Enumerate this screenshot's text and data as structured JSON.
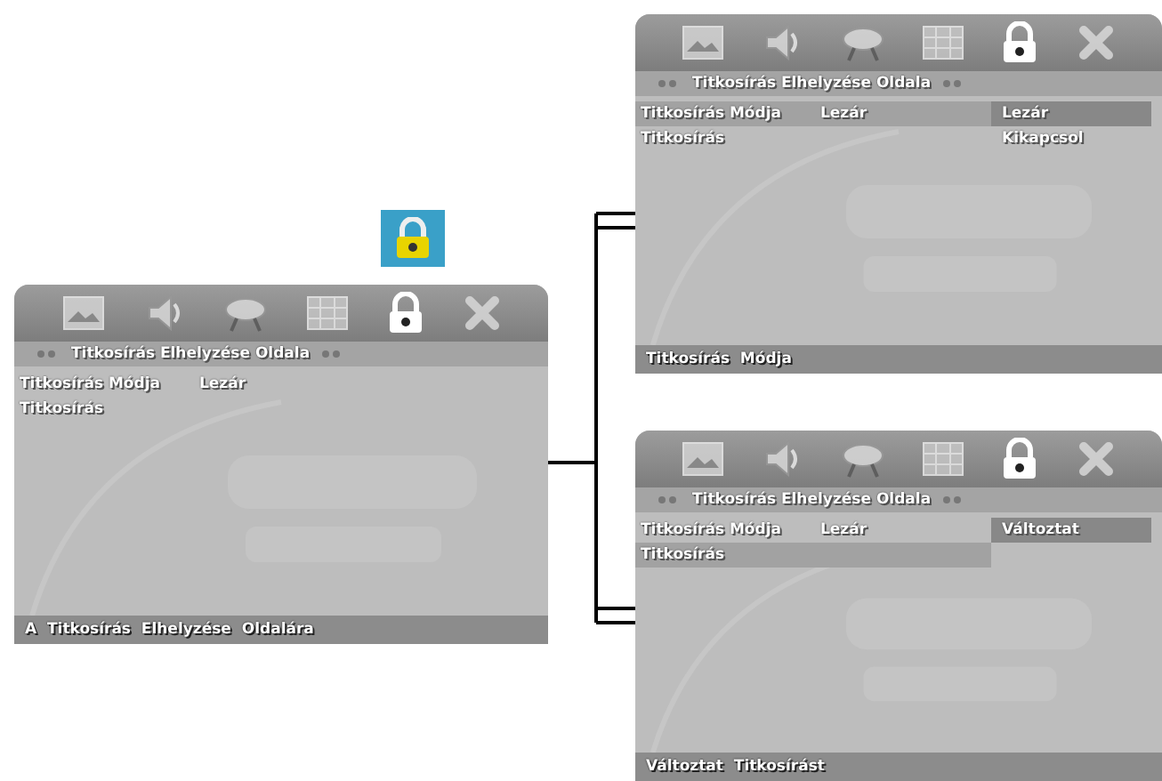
{
  "lock_badge": {
    "kind": "lock"
  },
  "screens": [
    {
      "toolbar": [
        {
          "kind": "image",
          "selected": false
        },
        {
          "kind": "audio",
          "selected": false
        },
        {
          "kind": "disc",
          "selected": false
        },
        {
          "kind": "screen",
          "selected": false
        },
        {
          "kind": "lock",
          "selected": true
        },
        {
          "kind": "close",
          "selected": false
        }
      ],
      "header": "Titkosírás Elhelyzése Oldala",
      "rows": [
        {
          "label": "Titkosírás Módja",
          "value": "Lezár",
          "selected": false
        },
        {
          "label": "Titkosírás",
          "selected": false
        }
      ],
      "footer": "A  Titkosírás  Elhelyzése  Oldalára"
    },
    {
      "toolbar": [
        {
          "kind": "image",
          "selected": false
        },
        {
          "kind": "audio",
          "selected": false
        },
        {
          "kind": "disc",
          "selected": false
        },
        {
          "kind": "screen",
          "selected": false
        },
        {
          "kind": "lock",
          "selected": true
        },
        {
          "kind": "close",
          "selected": false
        }
      ],
      "header": "Titkosírás Elhelyzése Oldala",
      "rows": [
        {
          "label": "Titkosírás Módja",
          "value": "Lezár",
          "selected": true
        },
        {
          "label": "Titkosírás",
          "selected": false
        }
      ],
      "options": [
        {
          "label": "Lezár",
          "selected": true
        },
        {
          "label": "Kikapcsol",
          "selected": false
        }
      ],
      "footer": "Titkosírás  Módja"
    },
    {
      "toolbar": [
        {
          "kind": "image",
          "selected": false
        },
        {
          "kind": "audio",
          "selected": false
        },
        {
          "kind": "disc",
          "selected": false
        },
        {
          "kind": "screen",
          "selected": false
        },
        {
          "kind": "lock",
          "selected": true
        },
        {
          "kind": "close",
          "selected": false
        }
      ],
      "header": "Titkosírás Elhelyzése Oldala",
      "rows": [
        {
          "label": "Titkosírás Módja",
          "value": "Lezár",
          "selected": false
        },
        {
          "label": "Titkosírás",
          "selected": true
        }
      ],
      "options": [
        {
          "label": "Változtat",
          "selected": true
        }
      ],
      "footer": "Változtat  Titkosírást"
    }
  ]
}
